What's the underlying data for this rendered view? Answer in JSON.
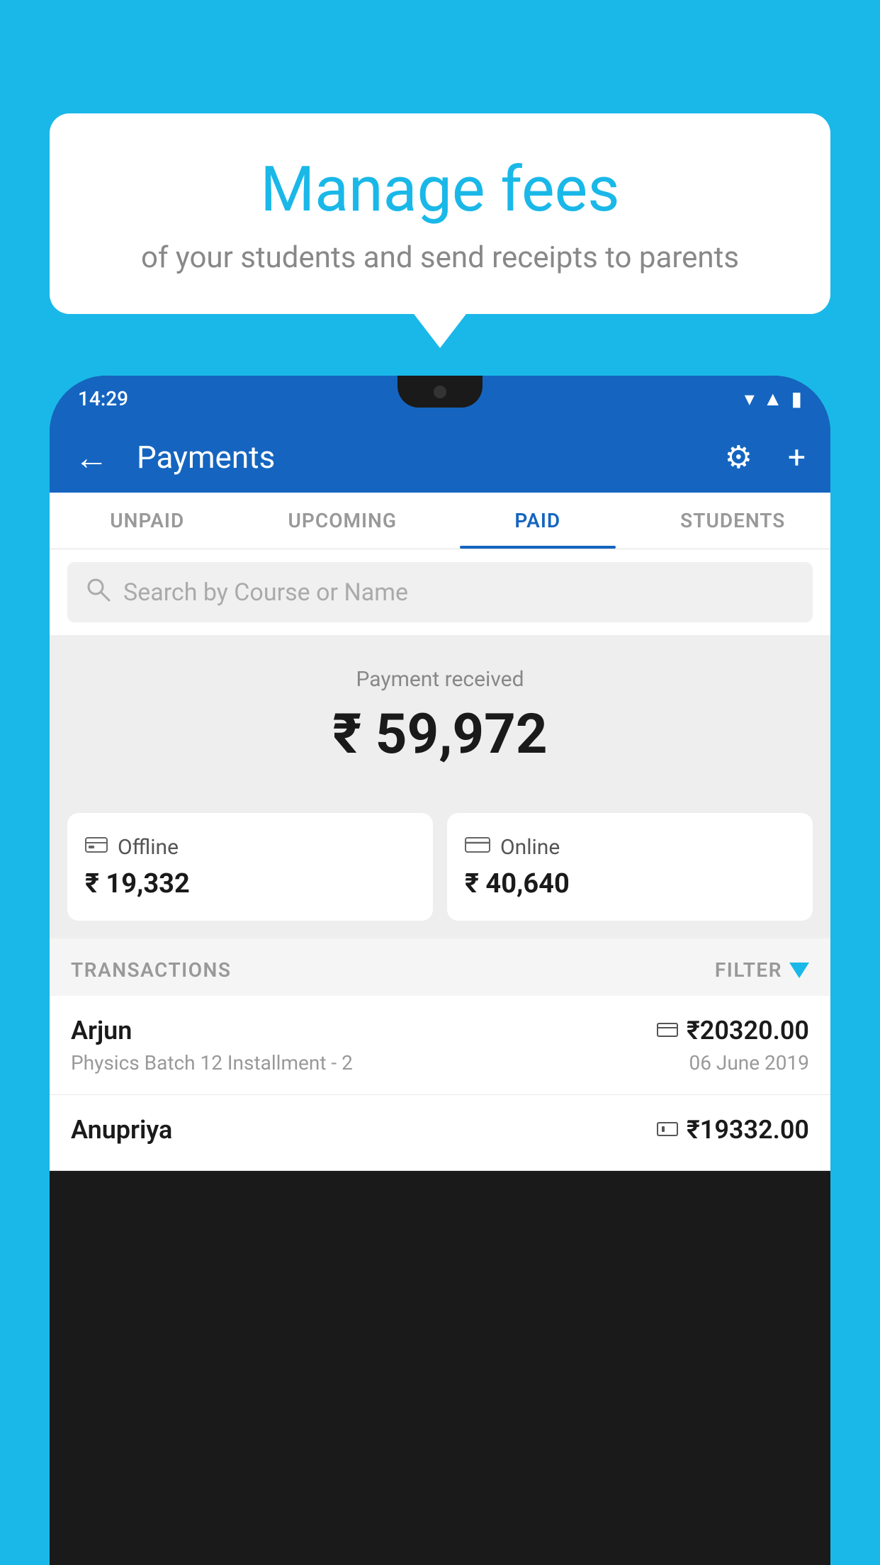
{
  "background_color": "#1ab8e8",
  "bubble": {
    "title": "Manage fees",
    "subtitle": "of your students and send receipts to parents"
  },
  "status_bar": {
    "time": "14:29"
  },
  "header": {
    "title": "Payments",
    "back_label": "←",
    "gear_label": "⚙",
    "plus_label": "+"
  },
  "tabs": [
    {
      "label": "UNPAID",
      "active": false
    },
    {
      "label": "UPCOMING",
      "active": false
    },
    {
      "label": "PAID",
      "active": true
    },
    {
      "label": "STUDENTS",
      "active": false
    }
  ],
  "search": {
    "placeholder": "Search by Course or Name"
  },
  "payment_received": {
    "label": "Payment received",
    "amount": "₹ 59,972"
  },
  "cards": [
    {
      "label": "Offline",
      "amount": "₹ 19,332",
      "icon_type": "offline"
    },
    {
      "label": "Online",
      "amount": "₹ 40,640",
      "icon_type": "online"
    }
  ],
  "transactions_label": "TRANSACTIONS",
  "filter_label": "FILTER",
  "transactions": [
    {
      "name": "Arjun",
      "course": "Physics Batch 12 Installment - 2",
      "amount": "₹20320.00",
      "date": "06 June 2019",
      "payment_type": "online"
    },
    {
      "name": "Anupriya",
      "course": "",
      "amount": "₹19332.00",
      "date": "",
      "payment_type": "offline"
    }
  ]
}
